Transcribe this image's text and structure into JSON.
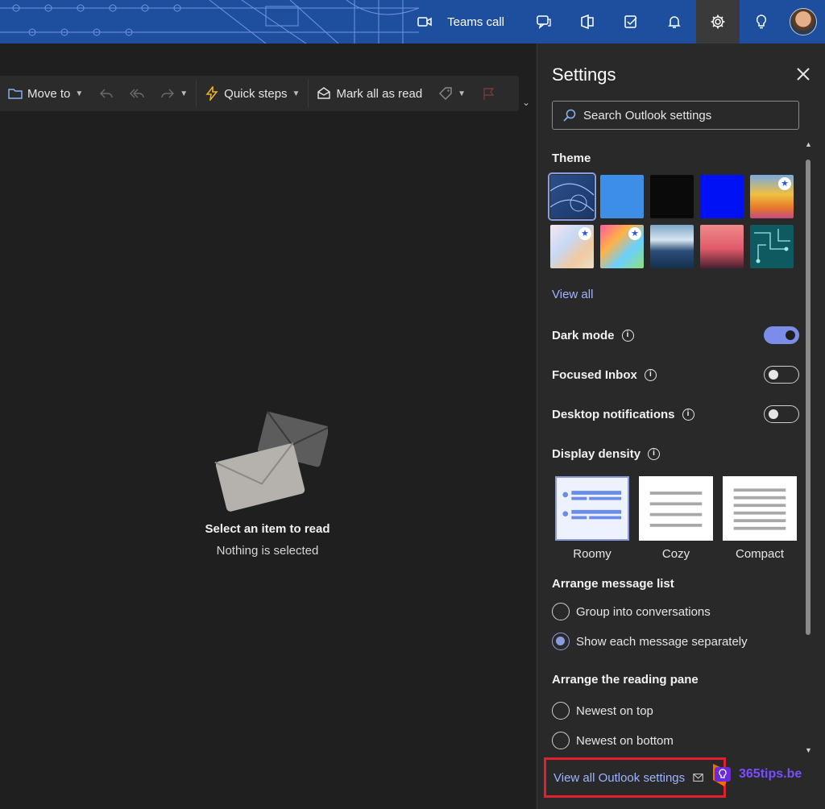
{
  "topbar": {
    "teams_call_label": "Teams call",
    "icons": [
      "video-icon",
      "chat-icon",
      "office-icon",
      "tasks-icon",
      "bell-icon",
      "gear-icon",
      "lightbulb-icon"
    ],
    "accent": "#1e4f9e"
  },
  "toolbar": {
    "move_to": "Move to",
    "quick_steps": "Quick steps",
    "mark_all_read": "Mark all as read"
  },
  "reading_pane": {
    "title": "Select an item to read",
    "subtitle": "Nothing is selected"
  },
  "settings": {
    "title": "Settings",
    "search_placeholder": "Search Outlook settings",
    "theme_label": "Theme",
    "view_all": "View all",
    "dark_mode": {
      "label": "Dark mode",
      "on": true
    },
    "focused_inbox": {
      "label": "Focused Inbox",
      "on": false
    },
    "desktop_notifications": {
      "label": "Desktop notifications",
      "on": false
    },
    "display_density": {
      "label": "Display density",
      "options": [
        "Roomy",
        "Cozy",
        "Compact"
      ],
      "selected": "Roomy"
    },
    "arrange_message_list": {
      "label": "Arrange message list",
      "options": [
        "Group into conversations",
        "Show each message separately"
      ],
      "selected": "Show each message separately"
    },
    "arrange_reading_pane": {
      "label": "Arrange the reading pane",
      "options": [
        "Newest on top",
        "Newest on bottom"
      ]
    },
    "view_all_settings": "View all Outlook settings"
  },
  "watermark": {
    "text": "365tips.be"
  }
}
